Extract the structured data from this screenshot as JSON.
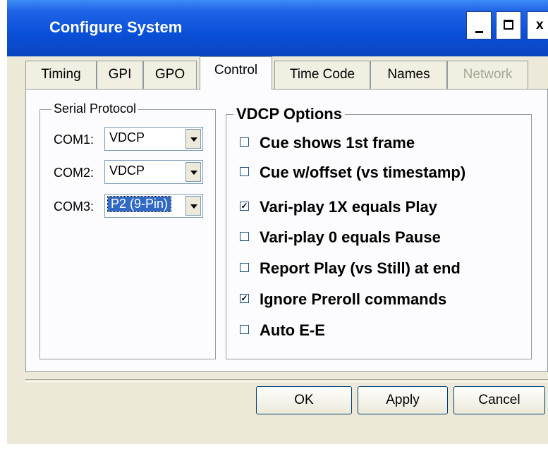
{
  "window": {
    "title": "Configure System"
  },
  "titlebar_buttons": {
    "minimize": "minimize",
    "maximize": "maximize",
    "close": "x"
  },
  "tabs": [
    {
      "label": "Timing",
      "state": "normal"
    },
    {
      "label": "GPI",
      "state": "normal"
    },
    {
      "label": "GPO",
      "state": "normal"
    },
    {
      "label": "Control",
      "state": "active"
    },
    {
      "label": "Time Code",
      "state": "normal"
    },
    {
      "label": "Names",
      "state": "normal"
    },
    {
      "label": "Network",
      "state": "disabled"
    }
  ],
  "serial_protocol": {
    "title": "Serial Protocol",
    "ports": [
      {
        "label": "COM1:",
        "value": "VDCP"
      },
      {
        "label": "COM2:",
        "value": "VDCP"
      },
      {
        "label": "COM3:",
        "value": "P2 (9-Pin)"
      }
    ]
  },
  "vdcp_options": {
    "title": "VDCP Options",
    "options": [
      {
        "label": "Cue shows 1st frame",
        "checked": false
      },
      {
        "label": "Cue w/offset (vs timestamp)",
        "checked": false
      },
      {
        "label": "Vari-play 1X equals Play",
        "checked": true
      },
      {
        "label": "Vari-play 0 equals Pause",
        "checked": false
      },
      {
        "label": "Report Play (vs Still) at end",
        "checked": false
      },
      {
        "label": "Ignore Preroll commands",
        "checked": true
      },
      {
        "label": "Auto E-E",
        "checked": false
      }
    ]
  },
  "buttons": {
    "ok": "OK",
    "apply": "Apply",
    "cancel": "Cancel"
  },
  "colors": {
    "titlebar": "#0a4fd8",
    "dialog_bg": "#ece9d8",
    "selection": "#316ac5"
  }
}
